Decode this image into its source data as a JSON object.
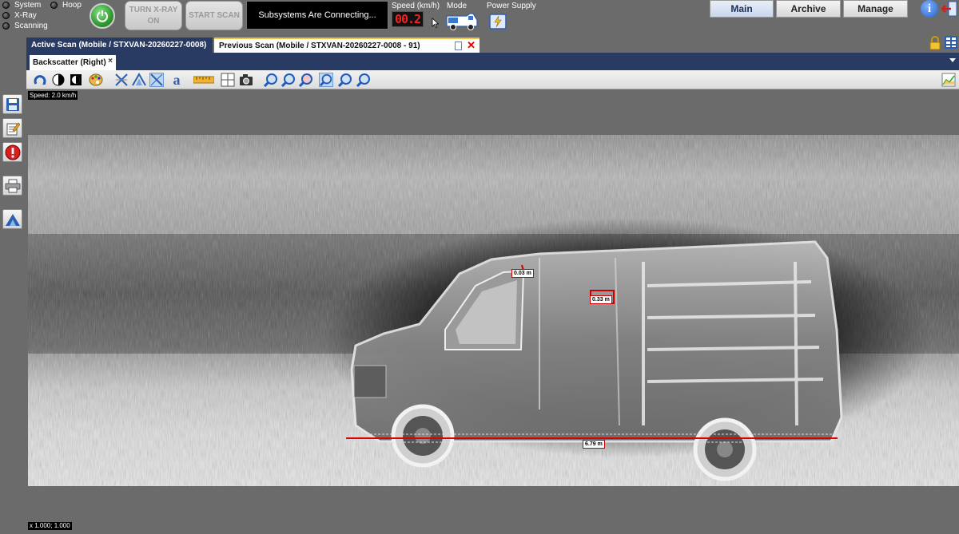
{
  "status_indicators": [
    {
      "label": "System"
    },
    {
      "label": "X-Ray"
    },
    {
      "label": "Scanning"
    },
    {
      "label": "Hoop"
    }
  ],
  "controls": {
    "turn_xray_label_line1": "TURN X-RAY",
    "turn_xray_label_line2": "ON",
    "start_scan_label": "START SCAN",
    "message": "Subsystems Are Connecting..."
  },
  "readouts": {
    "speed_label": "Speed (km/h)",
    "speed_value": "00.2",
    "mode_label": "Mode",
    "power_label": "Power Supply"
  },
  "nav": {
    "main": "Main",
    "archive": "Archive",
    "manage": "Manage"
  },
  "tabs": {
    "active": "Active Scan (Mobile / STXVAN-20260227-0008)",
    "previous": "Previous Scan (Mobile / STXVAN-20260227-0008 - 91)"
  },
  "subtab": {
    "label": "Backscatter (Right)",
    "close": "×"
  },
  "scan": {
    "speed_overlay": "Speed: 2.0 km/h",
    "scale_overlay": "x 1.000; 1.000",
    "measurements": [
      "0.03 m",
      "0.33 m",
      "6.79 m"
    ]
  },
  "colors": {
    "panel_bg": "#6b6b6b",
    "tab_active_bg": "#2a3b63",
    "measure_red": "#cc0000",
    "speed_red": "#ff1e1e",
    "power_green": "#2f9a2f"
  }
}
